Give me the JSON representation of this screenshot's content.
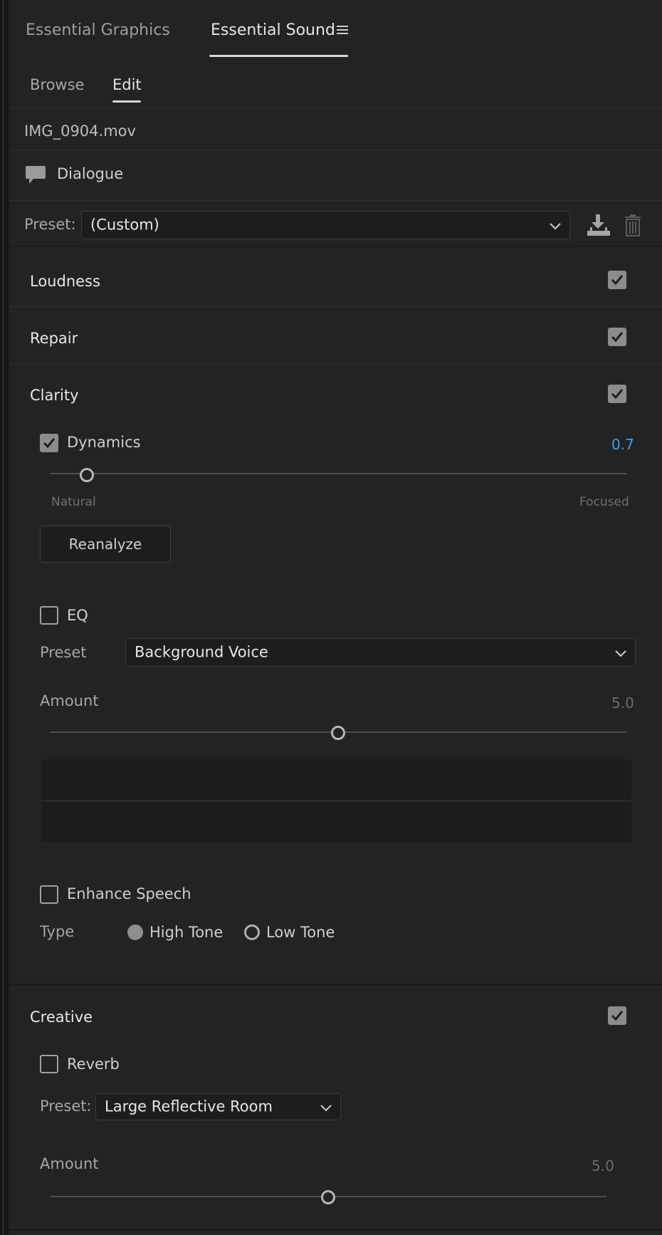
{
  "panel_tabs": {
    "graphics": "Essential Graphics",
    "sound": "Essential Sound"
  },
  "sub_tabs": {
    "browse": "Browse",
    "edit": "Edit"
  },
  "clip_name": "IMG_0904.mov",
  "audio_type": "Dialogue",
  "preset_row": {
    "label": "Preset:",
    "value": "(Custom)"
  },
  "sections": {
    "loudness": {
      "title": "Loudness",
      "checked": true
    },
    "repair": {
      "title": "Repair",
      "checked": true
    },
    "clarity": {
      "title": "Clarity",
      "checked": true,
      "dynamics": {
        "label": "Dynamics",
        "checked": true,
        "value": "0.7",
        "min_label": "Natural",
        "max_label": "Focused",
        "level": 0.07
      },
      "reanalyze_label": "Reanalyze",
      "eq": {
        "label": "EQ",
        "checked": false,
        "preset_label": "Preset",
        "preset_value": "Background Voice",
        "amount_label": "Amount",
        "amount_value": "5.0",
        "level": 0.5
      },
      "enhance": {
        "label": "Enhance Speech",
        "checked": false,
        "type_label": "Type",
        "option_high": "High Tone",
        "option_low": "Low Tone",
        "selected": "High Tone"
      }
    },
    "creative": {
      "title": "Creative",
      "checked": true,
      "reverb": {
        "label": "Reverb",
        "checked": false,
        "preset_label": "Preset:",
        "preset_value": "Large Reflective Room",
        "amount_label": "Amount",
        "amount_value": "5.0",
        "level": 0.5
      }
    }
  },
  "colors": {
    "accent_value": "#3aa0f0",
    "panel_bg": "#232323"
  }
}
